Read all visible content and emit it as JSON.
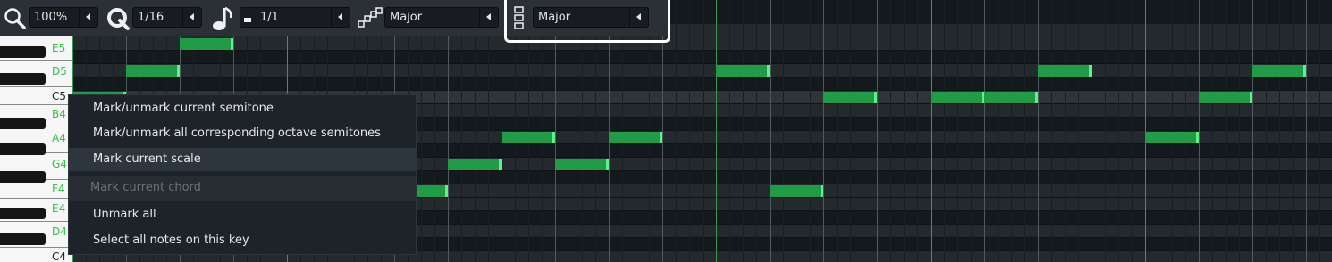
{
  "toolbar": {
    "zoom_value": "100%",
    "quantize_value": "1/16",
    "note_length_value": "1/1",
    "scale_value": "Major",
    "chord_value": "Major",
    "icons": [
      "zoom-icon",
      "quantize-icon",
      "note-length-icon",
      "scale-icon",
      "chord-icon"
    ]
  },
  "piano_keys": {
    "labels": [
      "E5",
      "D5",
      "C5",
      "B4",
      "A4",
      "G4",
      "F4",
      "E4",
      "D4",
      "C4"
    ],
    "label_color_marked": "#35c24b",
    "label_color_plain": "#222222"
  },
  "roll_colors": {
    "row_dark": "#14191d",
    "row_light": "#24292e",
    "row_scale": "#2e3438",
    "note_fill": "#1f9c45",
    "note_edge": "#5cf28a",
    "beat_line": "#3fa35a"
  },
  "context_menu": {
    "items": [
      {
        "label": "Mark/unmark current semitone",
        "state": "normal"
      },
      {
        "label": "Mark/unmark all corresponding octave semitones",
        "state": "normal"
      },
      {
        "label": "Mark current scale",
        "state": "hover"
      },
      {
        "label": "Mark current chord",
        "state": "disabled"
      },
      {
        "label": "Unmark all",
        "state": "normal"
      },
      {
        "label": "Select all notes on this key",
        "state": "normal"
      }
    ]
  },
  "notes": [
    {
      "pitch": "E5",
      "step": 8,
      "len": 4
    },
    {
      "pitch": "D5",
      "step": 4,
      "len": 4
    },
    {
      "pitch": "D5",
      "step": 48,
      "len": 4
    },
    {
      "pitch": "D5",
      "step": 72,
      "len": 4
    },
    {
      "pitch": "D5",
      "step": 88,
      "len": 4
    },
    {
      "pitch": "C5",
      "step": 0,
      "len": 4
    },
    {
      "pitch": "C5",
      "step": 56,
      "len": 4
    },
    {
      "pitch": "C5",
      "step": 64,
      "len": 4
    },
    {
      "pitch": "C5",
      "step": 68,
      "len": 4
    },
    {
      "pitch": "C5",
      "step": 84,
      "len": 4
    },
    {
      "pitch": "A4",
      "step": 32,
      "len": 4
    },
    {
      "pitch": "A4",
      "step": 40,
      "len": 4
    },
    {
      "pitch": "A4",
      "step": 80,
      "len": 4
    },
    {
      "pitch": "G4",
      "step": 28,
      "len": 4
    },
    {
      "pitch": "G4",
      "step": 36,
      "len": 4
    },
    {
      "pitch": "F4",
      "step": 24,
      "len": 4
    },
    {
      "pitch": "F4",
      "step": 52,
      "len": 4
    }
  ]
}
